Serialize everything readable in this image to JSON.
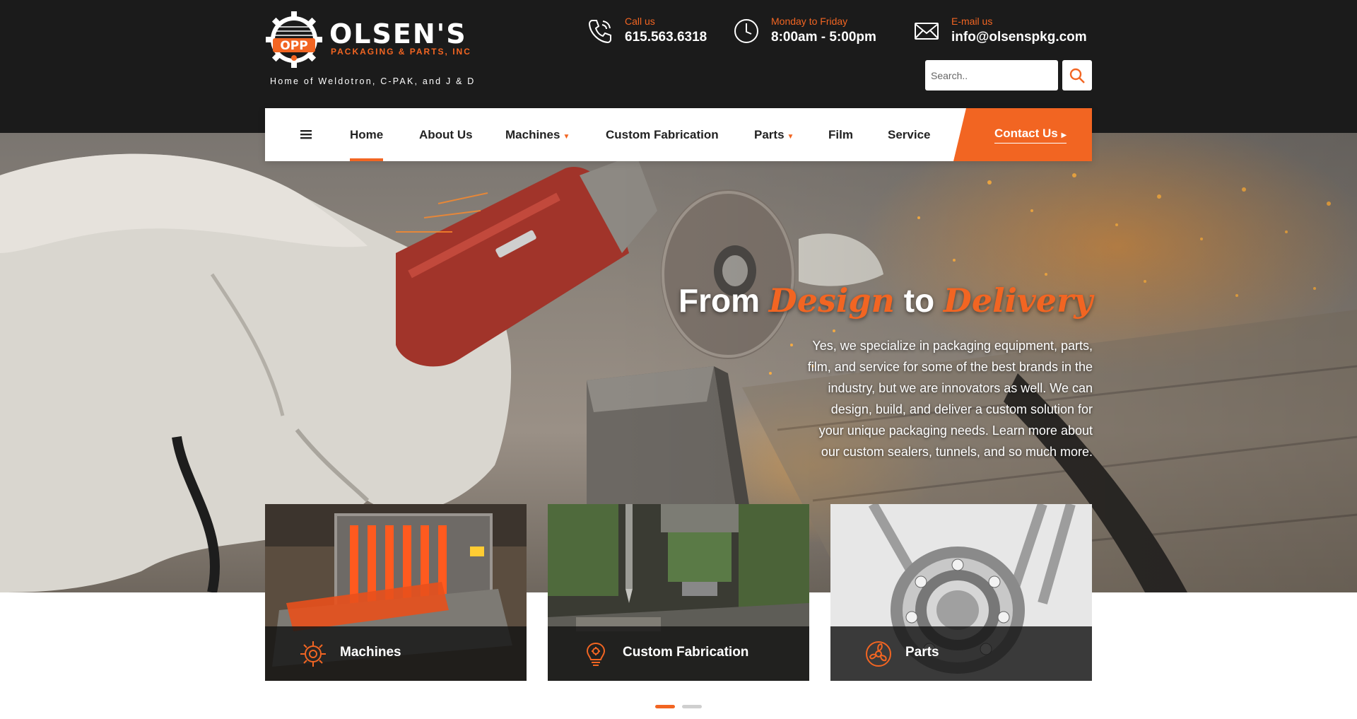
{
  "brand": {
    "name": "OLSEN'S",
    "sub": "PACKAGING & PARTS, INC",
    "emblem": "OPP",
    "tagline": "Home of Weldotron, C-PAK, and J & D"
  },
  "contact": {
    "call_label": "Call us",
    "call_value": "615.563.6318",
    "hours_label": "Monday to Friday",
    "hours_value": "8:00am - 5:00pm",
    "email_label": "E-mail us",
    "email_value": "info@olsenspkg.com"
  },
  "search": {
    "placeholder": "Search.."
  },
  "nav": {
    "items": [
      {
        "label": "Home",
        "active": true
      },
      {
        "label": "About Us"
      },
      {
        "label": "Machines",
        "dropdown": true
      },
      {
        "label": "Custom Fabrication"
      },
      {
        "label": "Parts",
        "dropdown": true
      },
      {
        "label": "Film"
      },
      {
        "label": "Service"
      }
    ],
    "cta": "Contact Us"
  },
  "hero": {
    "title_a": "From ",
    "title_b": "Design",
    "title_c": " to ",
    "title_d": "Delivery",
    "text": "Yes, we specialize in packaging equipment, parts, film, and service for some of the best brands in the industry, but we are innovators as well. We can design, build, and deliver a custom solution for your unique packaging needs. Learn more about our custom sealers, tunnels, and so much more."
  },
  "cards": [
    {
      "label": "Machines",
      "icon": "gear-icon"
    },
    {
      "label": "Custom Fabrication",
      "icon": "lightbulb-gear-icon"
    },
    {
      "label": "Parts",
      "icon": "fan-blade-icon"
    }
  ],
  "pager": {
    "count": 2,
    "active": 1
  },
  "colors": {
    "accent": "#f26522",
    "dark": "#1b1b1b"
  }
}
